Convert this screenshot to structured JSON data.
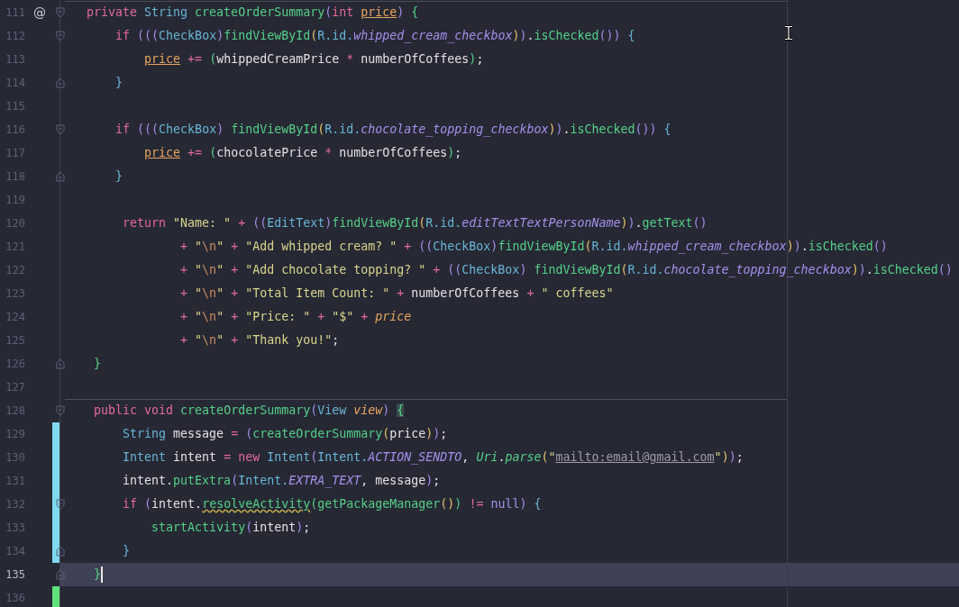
{
  "editor": {
    "lines": [
      {
        "number": "111",
        "gutter_mark": "@",
        "fold_start": true,
        "fold_end": false,
        "modified": false,
        "added": false,
        "current": false,
        "separator": true,
        "tokens": [
          {
            "text": "private ",
            "kind": "kw"
          },
          {
            "text": "String ",
            "kind": "ty"
          },
          {
            "text": "createOrderSummary",
            "kind": "fn"
          },
          {
            "text": "(",
            "kind": "pa"
          },
          {
            "text": "int ",
            "kind": "kw"
          },
          {
            "text": "price",
            "kind": "par"
          },
          {
            "text": ") ",
            "kind": "pa"
          },
          {
            "text": "{",
            "kind": "pc"
          }
        ]
      },
      {
        "number": "112",
        "fold_start": true,
        "fold_end": false,
        "modified": false,
        "added": false,
        "current": false,
        "separator": false,
        "tokens": [
          {
            "text": "    if ",
            "kind": "kw"
          },
          {
            "text": "(((",
            "kind": "pa"
          },
          {
            "text": "CheckBox",
            "kind": "ty"
          },
          {
            "text": ")",
            "kind": "pa"
          },
          {
            "text": "findViewById",
            "kind": "fn"
          },
          {
            "text": "(",
            "kind": "pb"
          },
          {
            "text": "R.id.",
            "kind": "ty"
          },
          {
            "text": "whipped_cream_checkbox",
            "kind": "fld"
          },
          {
            "text": ")",
            "kind": "pb"
          },
          {
            "text": ")",
            "kind": "pa"
          },
          {
            "text": ".",
            "kind": "pl"
          },
          {
            "text": "isChecked",
            "kind": "fn"
          },
          {
            "text": "()",
            "kind": "pa"
          },
          {
            "text": ") ",
            "kind": "pa"
          },
          {
            "text": "{",
            "kind": "pd"
          }
        ]
      },
      {
        "number": "113",
        "fold_start": false,
        "fold_end": false,
        "modified": false,
        "added": false,
        "current": false,
        "separator": false,
        "tokens": [
          {
            "text": "        price",
            "kind": "par"
          },
          {
            "text": " += ",
            "kind": "kw"
          },
          {
            "text": "(",
            "kind": "pc"
          },
          {
            "text": "whippedCreamPrice ",
            "kind": "pl"
          },
          {
            "text": "* ",
            "kind": "kw"
          },
          {
            "text": "numberOfCoffees",
            "kind": "pl"
          },
          {
            "text": ")",
            "kind": "pc"
          },
          {
            "text": ";",
            "kind": "pl"
          }
        ]
      },
      {
        "number": "114",
        "fold_start": false,
        "fold_end": true,
        "modified": false,
        "added": false,
        "current": false,
        "separator": false,
        "tokens": [
          {
            "text": "    }",
            "kind": "pd"
          }
        ]
      },
      {
        "number": "115",
        "fold_start": false,
        "fold_end": false,
        "modified": false,
        "added": false,
        "current": false,
        "separator": false
      },
      {
        "number": "116",
        "fold_start": true,
        "fold_end": false,
        "modified": false,
        "added": false,
        "current": false,
        "separator": false,
        "tokens": [
          {
            "text": "    if ",
            "kind": "kw"
          },
          {
            "text": "(((",
            "kind": "pa"
          },
          {
            "text": "CheckBox",
            "kind": "ty"
          },
          {
            "text": ") ",
            "kind": "pa"
          },
          {
            "text": "findViewById",
            "kind": "fn"
          },
          {
            "text": "(",
            "kind": "pb"
          },
          {
            "text": "R.id.",
            "kind": "ty"
          },
          {
            "text": "chocolate_topping_checkbox",
            "kind": "fld"
          },
          {
            "text": ")",
            "kind": "pb"
          },
          {
            "text": ")",
            "kind": "pa"
          },
          {
            "text": ".",
            "kind": "pl"
          },
          {
            "text": "isChecked",
            "kind": "fn"
          },
          {
            "text": "()",
            "kind": "pa"
          },
          {
            "text": ") ",
            "kind": "pa"
          },
          {
            "text": "{",
            "kind": "pd"
          }
        ]
      },
      {
        "number": "117",
        "fold_start": false,
        "fold_end": false,
        "modified": false,
        "added": false,
        "current": false,
        "separator": false,
        "tokens": [
          {
            "text": "        price",
            "kind": "par"
          },
          {
            "text": " += ",
            "kind": "kw"
          },
          {
            "text": "(",
            "kind": "pc"
          },
          {
            "text": "chocolatePrice ",
            "kind": "pl"
          },
          {
            "text": "* ",
            "kind": "kw"
          },
          {
            "text": "numberOfCoffees",
            "kind": "pl"
          },
          {
            "text": ")",
            "kind": "pc"
          },
          {
            "text": ";",
            "kind": "pl"
          }
        ]
      },
      {
        "number": "118",
        "fold_start": false,
        "fold_end": true,
        "modified": false,
        "added": false,
        "current": false,
        "separator": false,
        "tokens": [
          {
            "text": "    }",
            "kind": "pd"
          }
        ]
      },
      {
        "number": "119",
        "fold_start": false,
        "fold_end": false,
        "modified": false,
        "added": false,
        "current": false,
        "separator": false
      },
      {
        "number": "120",
        "fold_start": false,
        "fold_end": false,
        "modified": false,
        "added": false,
        "current": false,
        "separator": false,
        "tokens": [
          {
            "text": "     return ",
            "kind": "kw"
          },
          {
            "text": "\"Name: \" ",
            "kind": "str"
          },
          {
            "text": "+ ",
            "kind": "kw"
          },
          {
            "text": "((",
            "kind": "pa"
          },
          {
            "text": "EditText",
            "kind": "ty"
          },
          {
            "text": ")",
            "kind": "pa"
          },
          {
            "text": "findViewById",
            "kind": "fn"
          },
          {
            "text": "(",
            "kind": "pb"
          },
          {
            "text": "R.id.",
            "kind": "ty"
          },
          {
            "text": "editTextTextPersonName",
            "kind": "fld"
          },
          {
            "text": ")",
            "kind": "pb"
          },
          {
            "text": ")",
            "kind": "pa"
          },
          {
            "text": ".",
            "kind": "pl"
          },
          {
            "text": "getText",
            "kind": "fn"
          },
          {
            "text": "()",
            "kind": "pa"
          }
        ]
      },
      {
        "number": "121",
        "fold_start": false,
        "fold_end": false,
        "modified": false,
        "added": false,
        "current": false,
        "separator": false,
        "tokens": [
          {
            "text": "             + ",
            "kind": "kw"
          },
          {
            "text": "\"",
            "kind": "str"
          },
          {
            "text": "\\n",
            "kind": "esc"
          },
          {
            "text": "\" ",
            "kind": "str"
          },
          {
            "text": "+ ",
            "kind": "kw"
          },
          {
            "text": "\"Add whipped cream? \" ",
            "kind": "str"
          },
          {
            "text": "+ ",
            "kind": "kw"
          },
          {
            "text": "((",
            "kind": "pa"
          },
          {
            "text": "CheckBox",
            "kind": "ty"
          },
          {
            "text": ")",
            "kind": "pa"
          },
          {
            "text": "findViewById",
            "kind": "fn"
          },
          {
            "text": "(",
            "kind": "pb"
          },
          {
            "text": "R.id.",
            "kind": "ty"
          },
          {
            "text": "whipped_cream_checkbox",
            "kind": "fld"
          },
          {
            "text": ")",
            "kind": "pb"
          },
          {
            "text": ")",
            "kind": "pa"
          },
          {
            "text": ".",
            "kind": "pl"
          },
          {
            "text": "isChecked",
            "kind": "fn"
          },
          {
            "text": "()",
            "kind": "pa"
          }
        ]
      },
      {
        "number": "122",
        "fold_start": false,
        "fold_end": false,
        "modified": false,
        "added": false,
        "current": false,
        "separator": false,
        "tokens": [
          {
            "text": "             + ",
            "kind": "kw"
          },
          {
            "text": "\"",
            "kind": "str"
          },
          {
            "text": "\\n",
            "kind": "esc"
          },
          {
            "text": "\" ",
            "kind": "str"
          },
          {
            "text": "+ ",
            "kind": "kw"
          },
          {
            "text": "\"Add chocolate topping? \" ",
            "kind": "str"
          },
          {
            "text": "+ ",
            "kind": "kw"
          },
          {
            "text": "((",
            "kind": "pa"
          },
          {
            "text": "CheckBox",
            "kind": "ty"
          },
          {
            "text": ") ",
            "kind": "pa"
          },
          {
            "text": "findViewById",
            "kind": "fn"
          },
          {
            "text": "(",
            "kind": "pb"
          },
          {
            "text": "R.id.",
            "kind": "ty"
          },
          {
            "text": "chocolate_topping_checkbox",
            "kind": "fld"
          },
          {
            "text": ")",
            "kind": "pb"
          },
          {
            "text": ")",
            "kind": "pa"
          },
          {
            "text": ".",
            "kind": "pl"
          },
          {
            "text": "isChecked",
            "kind": "fn"
          },
          {
            "text": "()",
            "kind": "pa"
          }
        ]
      },
      {
        "number": "123",
        "fold_start": false,
        "fold_end": false,
        "modified": false,
        "added": false,
        "current": false,
        "separator": false,
        "tokens": [
          {
            "text": "             + ",
            "kind": "kw"
          },
          {
            "text": "\"",
            "kind": "str"
          },
          {
            "text": "\\n",
            "kind": "esc"
          },
          {
            "text": "\" ",
            "kind": "str"
          },
          {
            "text": "+ ",
            "kind": "kw"
          },
          {
            "text": "\"Total Item Count: \" ",
            "kind": "str"
          },
          {
            "text": "+ ",
            "kind": "kw"
          },
          {
            "text": "numberOfCoffees ",
            "kind": "pl"
          },
          {
            "text": "+ ",
            "kind": "kw"
          },
          {
            "text": "\" coffees\"",
            "kind": "str"
          }
        ]
      },
      {
        "number": "124",
        "fold_start": false,
        "fold_end": false,
        "modified": false,
        "added": false,
        "current": false,
        "separator": false,
        "tokens": [
          {
            "text": "             + ",
            "kind": "kw"
          },
          {
            "text": "\"",
            "kind": "str"
          },
          {
            "text": "\\n",
            "kind": "esc"
          },
          {
            "text": "\" ",
            "kind": "str"
          },
          {
            "text": "+ ",
            "kind": "kw"
          },
          {
            "text": "\"Price: \" ",
            "kind": "str"
          },
          {
            "text": "+ ",
            "kind": "kw"
          },
          {
            "text": "\"$\" ",
            "kind": "str"
          },
          {
            "text": "+ ",
            "kind": "kw"
          },
          {
            "text": "price",
            "kind": "pari"
          }
        ]
      },
      {
        "number": "125",
        "fold_start": false,
        "fold_end": false,
        "modified": false,
        "added": false,
        "current": false,
        "separator": false,
        "tokens": [
          {
            "text": "             + ",
            "kind": "kw"
          },
          {
            "text": "\"",
            "kind": "str"
          },
          {
            "text": "\\n",
            "kind": "esc"
          },
          {
            "text": "\" ",
            "kind": "str"
          },
          {
            "text": "+ ",
            "kind": "kw"
          },
          {
            "text": "\"Thank you!\"",
            "kind": "str"
          },
          {
            "text": ";",
            "kind": "pl"
          }
        ]
      },
      {
        "number": "126",
        "fold_start": false,
        "fold_end": true,
        "modified": false,
        "added": false,
        "current": false,
        "separator": false,
        "tokens": [
          {
            "text": " }",
            "kind": "pc"
          }
        ]
      },
      {
        "number": "127",
        "fold_start": false,
        "fold_end": false,
        "modified": false,
        "added": false,
        "current": false,
        "separator": false
      },
      {
        "number": "128",
        "fold_start": true,
        "fold_end": false,
        "modified": false,
        "added": false,
        "current": false,
        "separator": true,
        "tokens": [
          {
            "text": " public ",
            "kind": "kw"
          },
          {
            "text": "void ",
            "kind": "kw"
          },
          {
            "text": "createOrderSummary",
            "kind": "fn"
          },
          {
            "text": "(",
            "kind": "pa"
          },
          {
            "text": "View ",
            "kind": "ty"
          },
          {
            "text": "view",
            "kind": "pari"
          },
          {
            "text": ") ",
            "kind": "pa"
          },
          {
            "text": "{",
            "kind": "bm"
          }
        ]
      },
      {
        "number": "129",
        "fold_start": false,
        "fold_end": false,
        "modified": true,
        "added": false,
        "current": false,
        "separator": false,
        "tokens": [
          {
            "text": "     String ",
            "kind": "ty"
          },
          {
            "text": "message ",
            "kind": "pl"
          },
          {
            "text": "= ",
            "kind": "kw"
          },
          {
            "text": "(",
            "kind": "pa"
          },
          {
            "text": "createOrderSummary",
            "kind": "fn"
          },
          {
            "text": "(",
            "kind": "pb"
          },
          {
            "text": "price",
            "kind": "pl"
          },
          {
            "text": ")",
            "kind": "pb"
          },
          {
            "text": ")",
            "kind": "pa"
          },
          {
            "text": ";",
            "kind": "pl"
          }
        ]
      },
      {
        "number": "130",
        "fold_start": false,
        "fold_end": false,
        "modified": true,
        "added": false,
        "current": false,
        "separator": false,
        "tokens": [
          {
            "text": "     Intent ",
            "kind": "ty"
          },
          {
            "text": "intent ",
            "kind": "pl"
          },
          {
            "text": "= ",
            "kind": "kw"
          },
          {
            "text": "new ",
            "kind": "kw"
          },
          {
            "text": "Intent",
            "kind": "ty"
          },
          {
            "text": "(",
            "kind": "pa"
          },
          {
            "text": "Intent.",
            "kind": "ty"
          },
          {
            "text": "ACTION_SENDTO",
            "kind": "fld"
          },
          {
            "text": ", ",
            "kind": "pl"
          },
          {
            "text": "Uri",
            "kind": "fni"
          },
          {
            "text": ".",
            "kind": "pl"
          },
          {
            "text": "parse",
            "kind": "fni"
          },
          {
            "text": "(",
            "kind": "pb"
          },
          {
            "text": "\"",
            "kind": "str"
          },
          {
            "text": "mailto:email@gmail.com",
            "kind": "link"
          },
          {
            "text": "\"",
            "kind": "str"
          },
          {
            "text": ")",
            "kind": "pb"
          },
          {
            "text": ")",
            "kind": "pa"
          },
          {
            "text": ";",
            "kind": "pl"
          }
        ]
      },
      {
        "number": "131",
        "fold_start": false,
        "fold_end": false,
        "modified": true,
        "added": false,
        "current": false,
        "separator": false,
        "tokens": [
          {
            "text": "     intent.",
            "kind": "pl"
          },
          {
            "text": "putExtra",
            "kind": "fn"
          },
          {
            "text": "(",
            "kind": "pa"
          },
          {
            "text": "Intent.",
            "kind": "ty"
          },
          {
            "text": "EXTRA_TEXT",
            "kind": "fld"
          },
          {
            "text": ", ",
            "kind": "pl"
          },
          {
            "text": "message",
            "kind": "pl"
          },
          {
            "text": ")",
            "kind": "pa"
          },
          {
            "text": ";",
            "kind": "pl"
          }
        ]
      },
      {
        "number": "132",
        "fold_start": true,
        "fold_end": false,
        "modified": true,
        "added": false,
        "current": false,
        "separator": false,
        "tokens": [
          {
            "text": "     if ",
            "kind": "kw"
          },
          {
            "text": "(",
            "kind": "pa"
          },
          {
            "text": "intent.",
            "kind": "pl"
          },
          {
            "text": "resolveActivity",
            "kind": "warn"
          },
          {
            "text": "(",
            "kind": "pc"
          },
          {
            "text": "getPackageManager",
            "kind": "fn"
          },
          {
            "text": "()",
            "kind": "pb"
          },
          {
            "text": ")",
            "kind": "pc"
          },
          {
            "text": " != ",
            "kind": "kw"
          },
          {
            "text": "null",
            "kind": "nul"
          },
          {
            "text": ") ",
            "kind": "pa"
          },
          {
            "text": "{",
            "kind": "pd"
          }
        ]
      },
      {
        "number": "133",
        "fold_start": false,
        "fold_end": false,
        "modified": true,
        "added": false,
        "current": false,
        "separator": false,
        "tokens": [
          {
            "text": "         startActivity",
            "kind": "fn"
          },
          {
            "text": "(",
            "kind": "pa"
          },
          {
            "text": "intent",
            "kind": "pl"
          },
          {
            "text": ")",
            "kind": "pa"
          },
          {
            "text": ";",
            "kind": "pl"
          }
        ]
      },
      {
        "number": "134",
        "fold_start": false,
        "fold_end": true,
        "modified": true,
        "added": false,
        "current": false,
        "separator": false,
        "tokens": [
          {
            "text": "     }",
            "kind": "pd"
          }
        ]
      },
      {
        "number": "135",
        "fold_start": false,
        "fold_end": true,
        "modified": false,
        "added": false,
        "current": true,
        "separator": false,
        "tokens": [
          {
            "text": " }",
            "kind": "pc"
          }
        ]
      },
      {
        "number": "136",
        "fold_start": false,
        "fold_end": false,
        "modified": false,
        "added": true,
        "current": false,
        "separator": false
      }
    ]
  }
}
